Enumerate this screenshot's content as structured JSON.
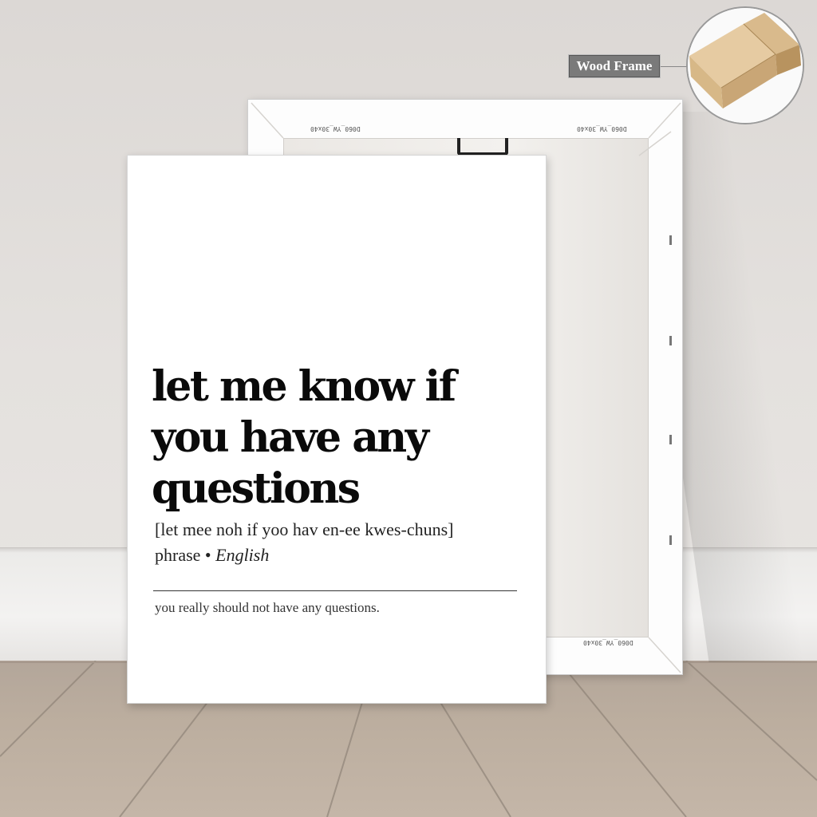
{
  "poster": {
    "term_line1": "let me know if",
    "term_line2": "you have any",
    "term_line3": "questions",
    "pronunciation": "[let mee noh if yoo hav en-ee kwes-chuns]",
    "part_of_speech": "phrase",
    "separator": "•",
    "language": "English",
    "definition": "you really should not have any questions."
  },
  "callout": {
    "label": "Wood Frame",
    "icon": "wood-frame-corner-icon"
  },
  "frame_back": {
    "stamp_text": "D060_YW_30x40"
  },
  "colors": {
    "wall": "#e2dfdc",
    "floor": "#bcae9f",
    "poster_bg": "#ffffff",
    "ink": "#0a0a0a",
    "wood": "#e0c49a",
    "label_bg": "#7a7a7a"
  }
}
